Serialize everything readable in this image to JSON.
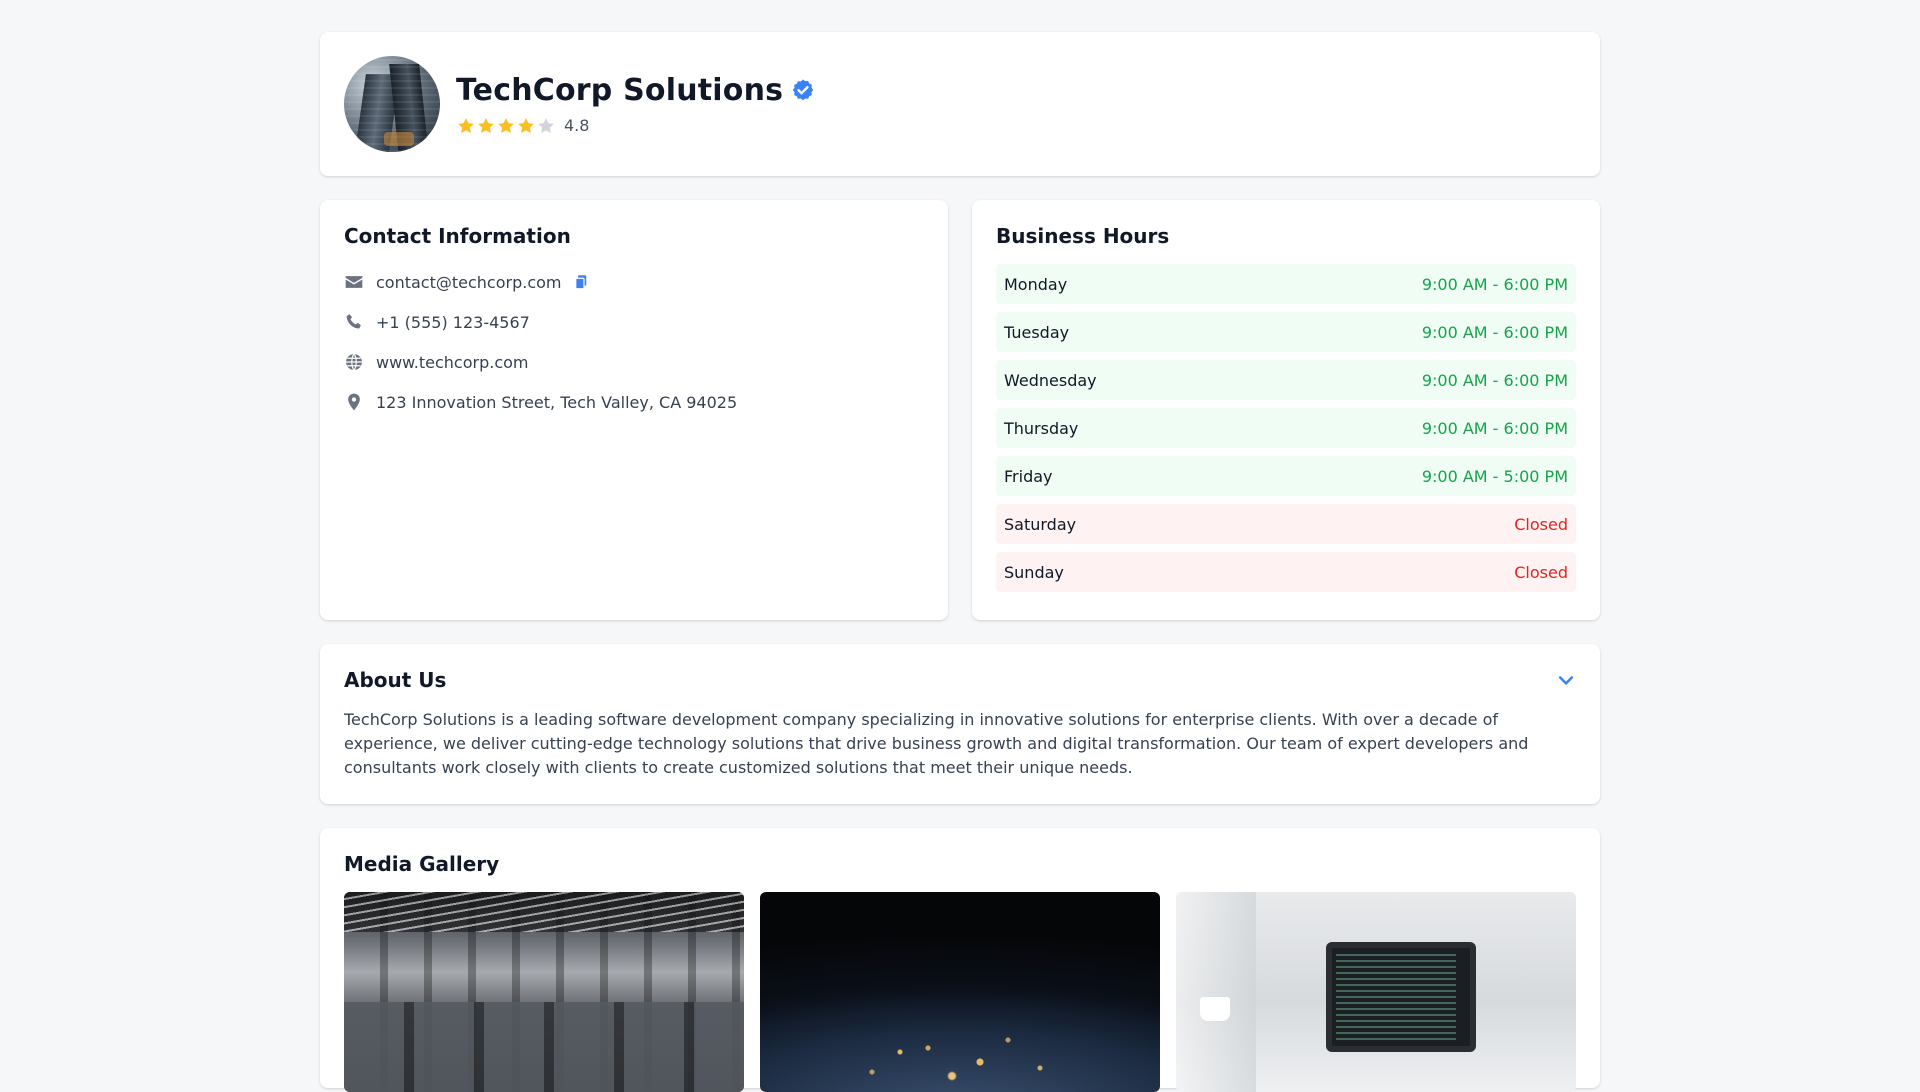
{
  "header": {
    "company_name": "TechCorp Solutions",
    "rating": "4.8",
    "rating_stars": {
      "filled": 4,
      "total": 5
    },
    "avatar_icon": "building-photo",
    "verified_icon": "verified-badge-icon"
  },
  "contact": {
    "title": "Contact Information",
    "items": [
      {
        "icon": "envelope-icon",
        "text": "contact@techcorp.com"
      },
      {
        "icon": "phone-icon",
        "text": "+1 (555) 123-4567"
      },
      {
        "icon": "globe-icon",
        "text": "www.techcorp.com"
      },
      {
        "icon": "map-pin-icon",
        "text": "123 Innovation Street, Tech Valley, CA 94025"
      }
    ],
    "copy_icon": "copy-icon"
  },
  "hours": {
    "title": "Business Hours",
    "rows": [
      {
        "day": "Monday",
        "time": "9:00 AM - 6:00 PM",
        "status": "open"
      },
      {
        "day": "Tuesday",
        "time": "9:00 AM - 6:00 PM",
        "status": "open"
      },
      {
        "day": "Wednesday",
        "time": "9:00 AM - 6:00 PM",
        "status": "open"
      },
      {
        "day": "Thursday",
        "time": "9:00 AM - 6:00 PM",
        "status": "open"
      },
      {
        "day": "Friday",
        "time": "9:00 AM - 5:00 PM",
        "status": "open"
      },
      {
        "day": "Saturday",
        "time": "Closed",
        "status": "closed"
      },
      {
        "day": "Sunday",
        "time": "Closed",
        "status": "closed"
      }
    ]
  },
  "about": {
    "title": "About Us",
    "text": "TechCorp Solutions is a leading software development company specializing in innovative solutions for enterprise clients. With over a decade of experience, we deliver cutting-edge technology solutions that drive business growth and digital transformation. Our team of expert developers and consultants work closely with clients to create customized solutions that meet their unique needs.",
    "toggle_icon": "chevron-down-icon"
  },
  "gallery": {
    "title": "Media Gallery",
    "images": [
      "office-photo",
      "earth-night-photo",
      "laptop-code-photo"
    ]
  },
  "colors": {
    "accent": "#3b82f6",
    "star": "#fbbf24",
    "open_text": "#16a34a",
    "open_bg": "#f0fdf4",
    "closed_text": "#dc2626",
    "closed_bg": "#fef2f2"
  }
}
